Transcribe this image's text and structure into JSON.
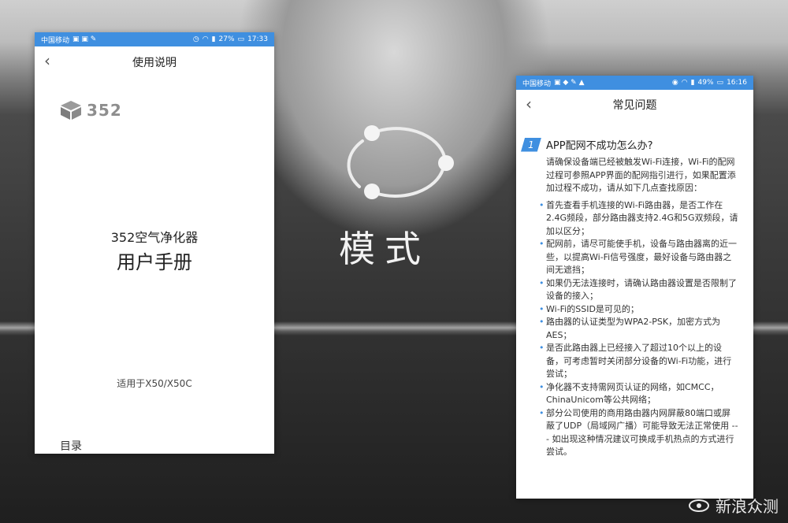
{
  "left_phone": {
    "status": {
      "carrier": "中国移动",
      "battery": "27%",
      "time": "17:33"
    },
    "nav_title": "使用说明",
    "logo_text": "352",
    "product_name": "352空气净化器",
    "manual_title": "用户手册",
    "applicable": "适用于X50/X50C",
    "toc": "目录"
  },
  "center": {
    "mode_text": "模式"
  },
  "right_phone": {
    "status": {
      "carrier": "中国移动",
      "battery": "49%",
      "time": "16:16"
    },
    "nav_title": "常见问题",
    "question_number": "1",
    "question": "APP配网不成功怎么办?",
    "intro": "请确保设备端已经被触发Wi-Fi连接，Wi-Fi的配网过程可参照APP界面的配网指引进行，如果配置添加过程不成功，请从如下几点查找原因：",
    "bullets": [
      "首先查看手机连接的Wi-Fi路由器，是否工作在2.4G频段，部分路由器支持2.4G和5G双频段，请加以区分；",
      "配网前，请尽可能使手机，设备与路由器离的近一些，以提高Wi-Fi信号强度，最好设备与路由器之间无遮挡；",
      "如果仍无法连接时，请确认路由器设置是否限制了设备的接入；",
      "Wi-Fi的SSID是可见的；",
      "路由器的认证类型为WPA2-PSK，加密方式为AES；",
      "是否此路由器上已经接入了超过10个以上的设备，可考虑暂时关闭部分设备的Wi-Fi功能，进行尝试；",
      "净化器不支持需网页认证的网络，如CMCC，ChinaUnicom等公共网络；",
      "部分公司使用的商用路由器内网屏蔽80端口或屏蔽了UDP（局域网广播）可能导致无法正常使用 --- 如出现这种情况建议可换成手机热点的方式进行尝试。"
    ]
  },
  "watermark": "新浪众测",
  "colors": {
    "status_bar": "#3f8fe0",
    "accent": "#3f8fe0"
  }
}
